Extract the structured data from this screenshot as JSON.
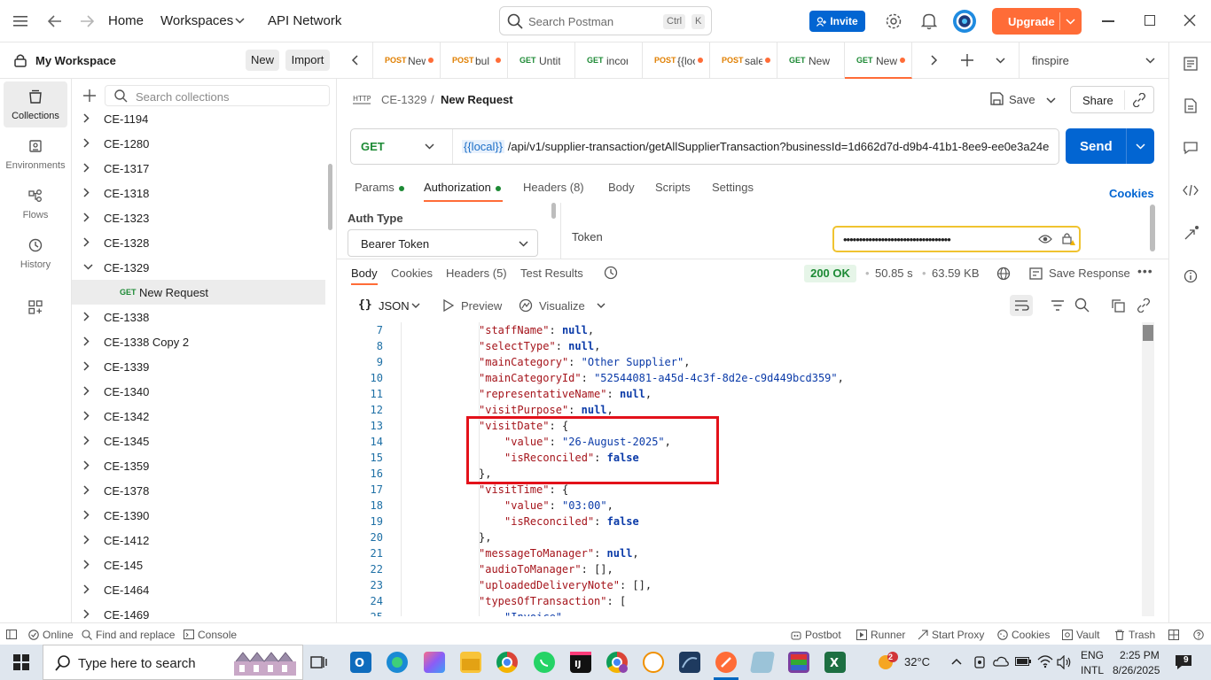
{
  "topbar": {
    "home": "Home",
    "workspaces": "Workspaces",
    "api_network": "API Network",
    "search_placeholder": "Search Postman",
    "shortcut_ctrl": "Ctrl",
    "shortcut_k": "K",
    "invite": "Invite",
    "upgrade": "Upgrade"
  },
  "workspace": {
    "name": "My Workspace",
    "new_label": "New",
    "import_label": "Import"
  },
  "rail": {
    "items": [
      {
        "label": "Collections",
        "icon": "collections-icon"
      },
      {
        "label": "Environments",
        "icon": "environments-icon"
      },
      {
        "label": "Flows",
        "icon": "flows-icon"
      },
      {
        "label": "History",
        "icon": "history-icon"
      }
    ]
  },
  "collections": {
    "search_placeholder": "Search collections",
    "items": [
      "CE-1194",
      "CE-1280",
      "CE-1317",
      "CE-1318",
      "CE-1323",
      "CE-1328",
      "CE-1329",
      "CE-1338",
      "CE-1338 Copy 2",
      "CE-1339",
      "CE-1340",
      "CE-1342",
      "CE-1345",
      "CE-1359",
      "CE-1378",
      "CE-1390",
      "CE-1412",
      "CE-145",
      "CE-1464",
      "CE-1469"
    ],
    "expanded_child": {
      "method": "GET",
      "name": "New Request"
    }
  },
  "tabs": [
    {
      "method": "POST",
      "title": "New"
    },
    {
      "method": "POST",
      "title": "bul"
    },
    {
      "method": "GET",
      "title": "Untitl"
    },
    {
      "method": "GET",
      "title": "incom"
    },
    {
      "method": "POST",
      "title": "{{loc"
    },
    {
      "method": "POST",
      "title": "sale"
    },
    {
      "method": "GET",
      "title": "New"
    },
    {
      "method": "GET",
      "title": "New"
    }
  ],
  "environment": "finspire",
  "request": {
    "collection": "CE-1329",
    "separator": "/",
    "name": "New Request",
    "save": "Save",
    "share": "Share",
    "method": "GET",
    "url_var": "{{local}}",
    "url_rest": " /api/v1/supplier-transaction/getAllSupplierTransaction?businessId=1d662d7d-d9b4-41b1-8ee9-ee0e3a24e",
    "send": "Send",
    "tab_params": "Params",
    "tab_auth": "Authorization",
    "tab_headers": "Headers (8)",
    "tab_body": "Body",
    "tab_scripts": "Scripts",
    "tab_settings": "Settings",
    "cookies": "Cookies"
  },
  "auth": {
    "label": "Auth Type",
    "type": "Bearer Token",
    "token_label": "Token",
    "token_value": "••••••••••••••••••••••••••••••••••"
  },
  "response": {
    "tab_body": "Body",
    "tab_cookies": "Cookies",
    "tab_headers": "Headers (5)",
    "tab_tests": "Test Results",
    "status": "200 OK",
    "time": "50.85 s",
    "size": "63.59 KB",
    "save_response": "Save Response",
    "format": "JSON",
    "preview": "Preview",
    "visualize": "Visualize"
  },
  "code": {
    "lines": [
      {
        "n": "7",
        "indent": 0,
        "key": "staffName",
        "val": "null",
        "type": "kw",
        "tail": ","
      },
      {
        "n": "8",
        "indent": 0,
        "key": "selectType",
        "val": "null",
        "type": "kw",
        "tail": ","
      },
      {
        "n": "9",
        "indent": 0,
        "key": "mainCategory",
        "val": "\"Other Supplier\"",
        "type": "s",
        "tail": ","
      },
      {
        "n": "10",
        "indent": 0,
        "key": "mainCategoryId",
        "val": "\"52544081-a45d-4c3f-8d2e-c9d449bcd359\"",
        "type": "s",
        "tail": ","
      },
      {
        "n": "11",
        "indent": 0,
        "key": "representativeName",
        "val": "null",
        "type": "kw",
        "tail": ","
      },
      {
        "n": "12",
        "indent": 0,
        "key": "visitPurpose",
        "val": "null",
        "type": "kw",
        "tail": ","
      },
      {
        "n": "13",
        "indent": 0,
        "key": "visitDate",
        "val": "{",
        "type": "p",
        "tail": ""
      },
      {
        "n": "14",
        "indent": 1,
        "key": "value",
        "val": "\"26-August-2025\"",
        "type": "s",
        "tail": ","
      },
      {
        "n": "15",
        "indent": 1,
        "key": "isReconciled",
        "val": "false",
        "type": "kw",
        "tail": ""
      },
      {
        "n": "16",
        "indent": 0,
        "key": "",
        "val": "},",
        "type": "p",
        "tail": ""
      },
      {
        "n": "17",
        "indent": 0,
        "key": "visitTime",
        "val": "{",
        "type": "p",
        "tail": ""
      },
      {
        "n": "18",
        "indent": 1,
        "key": "value",
        "val": "\"03:00\"",
        "type": "s",
        "tail": ","
      },
      {
        "n": "19",
        "indent": 1,
        "key": "isReconciled",
        "val": "false",
        "type": "kw",
        "tail": ""
      },
      {
        "n": "20",
        "indent": 0,
        "key": "",
        "val": "},",
        "type": "p",
        "tail": ""
      },
      {
        "n": "21",
        "indent": 0,
        "key": "messageToManager",
        "val": "null",
        "type": "kw",
        "tail": ","
      },
      {
        "n": "22",
        "indent": 0,
        "key": "audioToManager",
        "val": "[]",
        "type": "p",
        "tail": ","
      },
      {
        "n": "23",
        "indent": 0,
        "key": "uploadedDeliveryNote",
        "val": "[]",
        "type": "p",
        "tail": ","
      },
      {
        "n": "24",
        "indent": 0,
        "key": "typesOfTransaction",
        "val": "[",
        "type": "p",
        "tail": ""
      },
      {
        "n": "25",
        "indent": 1,
        "key": "",
        "val": "\"Invoice\"",
        "type": "s",
        "tail": ""
      }
    ]
  },
  "statusbar": {
    "online": "Online",
    "find_replace": "Find and replace",
    "console": "Console",
    "postbot": "Postbot",
    "runner": "Runner",
    "start_proxy": "Start Proxy",
    "cookies": "Cookies",
    "vault": "Vault",
    "trash": "Trash"
  },
  "taskbar": {
    "search_placeholder": "Type here to search",
    "temperature": "32°C",
    "weather_badge": "2",
    "lang1": "ENG",
    "lang2": "INTL",
    "time": "2:25 PM",
    "date": "8/26/2025",
    "notifications": "9"
  },
  "colors": {
    "accent": "#ff6c37",
    "primary": "#0265d2",
    "get": "#1d8a35",
    "highlight_box": "#e3111a"
  }
}
